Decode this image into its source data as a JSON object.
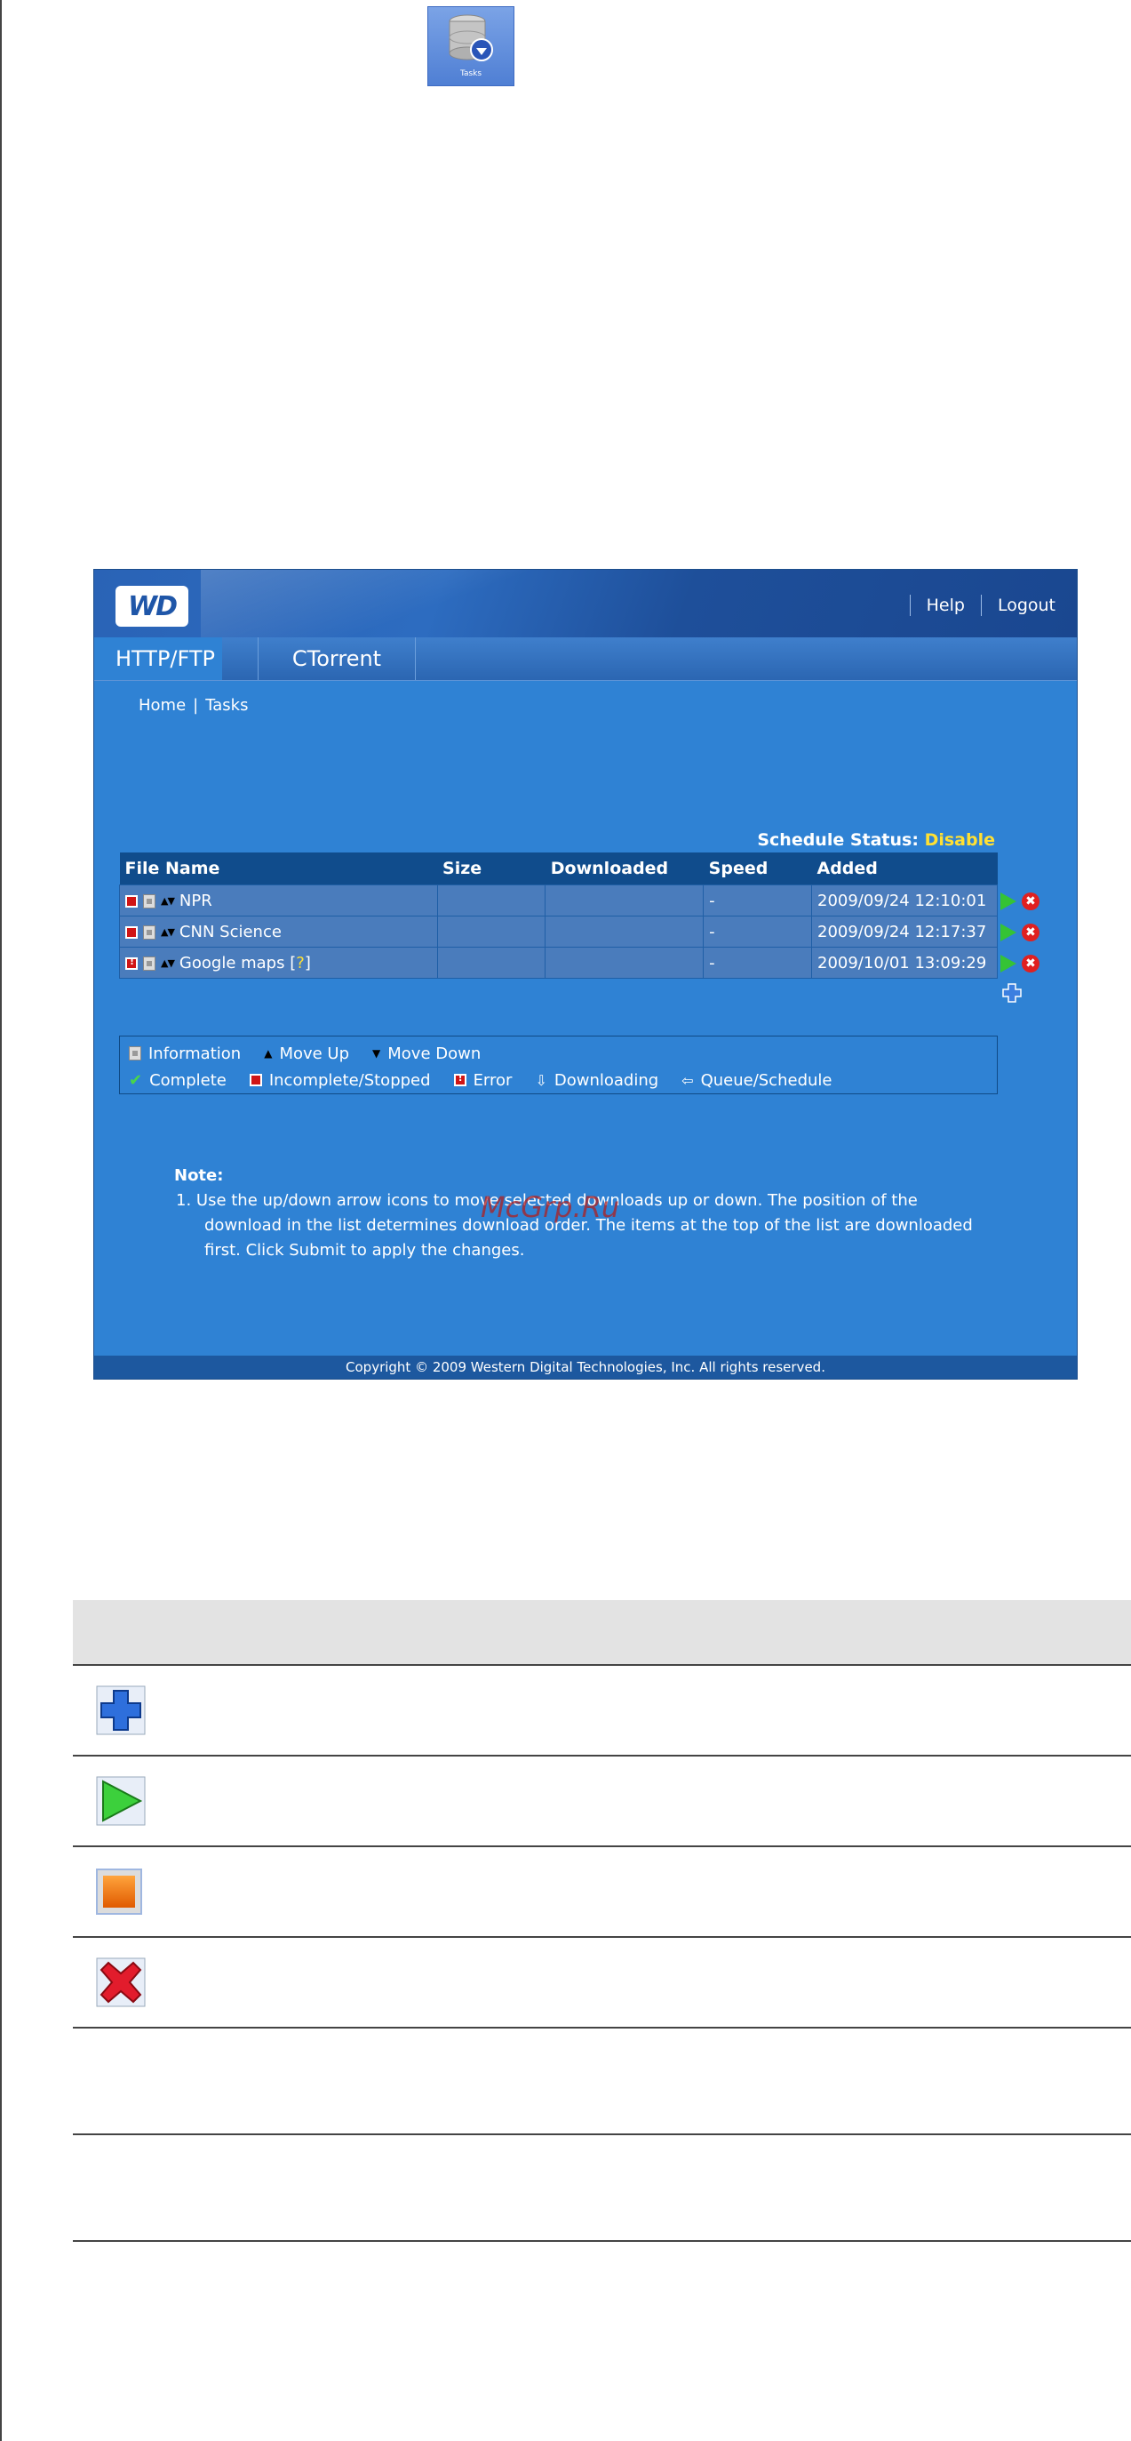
{
  "tasks_icon": {
    "label": "Tasks"
  },
  "app": {
    "logo": "WD",
    "top_links": [
      "Help",
      "Logout"
    ],
    "tabs": [
      "HTTP/FTP",
      "CTorrent"
    ],
    "breadcrumb": [
      "Home",
      "Tasks"
    ],
    "schedule": {
      "label": "Schedule Status:",
      "value": "Disable"
    },
    "table": {
      "headers": [
        "File Name",
        "Size",
        "Downloaded",
        "Speed",
        "Added"
      ],
      "rows": [
        {
          "status": "stopped",
          "name": "NPR",
          "size": "",
          "downloaded": "",
          "speed": "-",
          "added": "2009/09/24 12:10:01"
        },
        {
          "status": "stopped",
          "name": "CNN Science",
          "size": "",
          "downloaded": "",
          "speed": "-",
          "added": "2009/09/24 12:17:37"
        },
        {
          "status": "error",
          "name": "Google maps",
          "name_suffix": "?",
          "size": "",
          "downloaded": "",
          "speed": "-",
          "added": "2009/10/01 13:09:29"
        }
      ]
    },
    "legend": {
      "line1": [
        "Information",
        "Move Up",
        "Move Down"
      ],
      "line2": [
        "Complete",
        "Incomplete/Stopped",
        "Error",
        "Downloading",
        "Queue/Schedule"
      ]
    },
    "note": {
      "title": "Note:",
      "text": "1.  Use the up/down arrow icons to move selected downloads up or down. The position of the download in the list determines download order. The items at the top of the list are downloaded first. Click Submit to apply the changes."
    },
    "watermark": "McGrp.Ru",
    "footer": "Copyright © 2009 Western Digital Technologies, Inc. All rights reserved."
  },
  "icon_table_rows": [
    "add-icon",
    "play-icon",
    "stop-icon",
    "delete-icon",
    "",
    ""
  ],
  "colors": {
    "panel": "#2f82d4",
    "header_row": "#104c8c",
    "schedule_value": "#ffe033"
  }
}
